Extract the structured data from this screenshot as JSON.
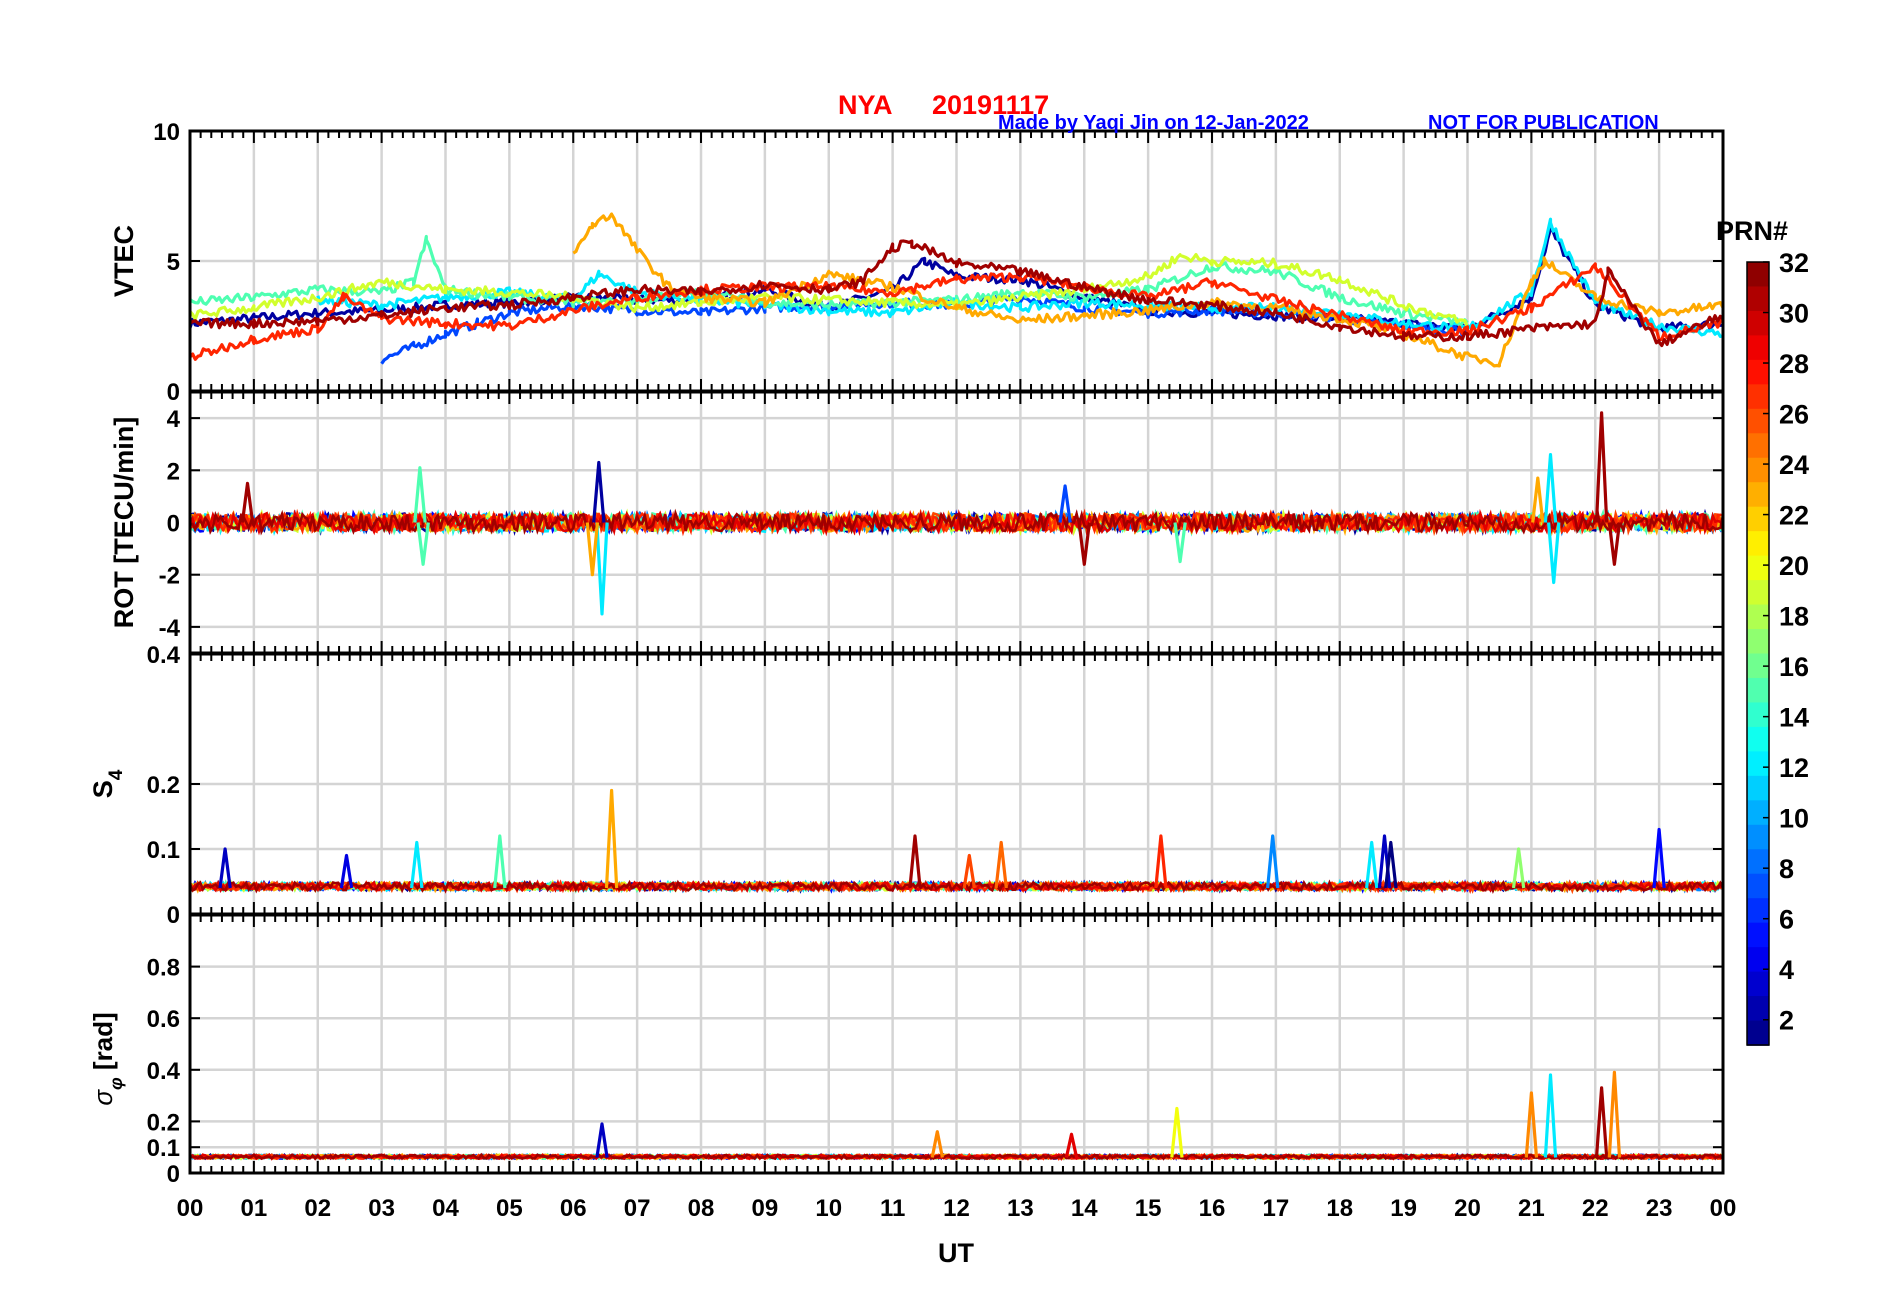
{
  "header": {
    "station": "NYA",
    "date": "20191117",
    "credit": "Made by Yaqi Jin on 12-Jan-2022",
    "notice": "NOT FOR PUBLICATION"
  },
  "colorbar": {
    "title": "PRN#",
    "ticks": [
      "2",
      "4",
      "6",
      "8",
      "10",
      "12",
      "14",
      "16",
      "18",
      "20",
      "22",
      "24",
      "26",
      "28",
      "30",
      "32"
    ],
    "colormap": "jet",
    "range": [
      1,
      32
    ]
  },
  "chart_data": [
    {
      "type": "line",
      "panel": "vtec",
      "ylabel": "VTEC",
      "ylim": [
        0,
        10
      ],
      "yticks": [
        "0",
        "5",
        "10"
      ],
      "grid": true,
      "xlim": [
        0,
        24
      ],
      "series": [
        {
          "prn": 2,
          "x": [
            0,
            1,
            2,
            3,
            4,
            5,
            6,
            7,
            8,
            9,
            10,
            11,
            11.5,
            12,
            13,
            14,
            15,
            16,
            17,
            18,
            19,
            20,
            21,
            21.3,
            22,
            23,
            24
          ],
          "values": [
            2.6,
            2.8,
            3.0,
            3.1,
            3.3,
            3.4,
            3.6,
            3.5,
            3.5,
            3.9,
            3.2,
            3.9,
            5.0,
            4.4,
            4.3,
            3.6,
            3.1,
            3.0,
            2.9,
            2.8,
            2.6,
            2.4,
            3.6,
            6.2,
            3.3,
            2.4,
            2.6
          ]
        },
        {
          "prn": 7,
          "x": [
            3,
            3.5,
            4,
            4.5,
            5,
            6,
            7,
            8,
            9,
            10,
            11,
            12,
            13,
            14,
            15,
            16,
            17,
            18,
            19,
            20
          ],
          "values": [
            1.2,
            1.7,
            2.2,
            2.6,
            3.0,
            3.3,
            3.1,
            3.0,
            3.2,
            3.3,
            3.4,
            3.3,
            3.6,
            3.2,
            3.0,
            3.1,
            3.0,
            2.8,
            2.5,
            2.3
          ]
        },
        {
          "prn": 12,
          "x": [
            2,
            3,
            4,
            5,
            6,
            6.4,
            7,
            8,
            9,
            10,
            11,
            12,
            13,
            14,
            15,
            16,
            17,
            18,
            19,
            20,
            21,
            21.3,
            22,
            23,
            24
          ],
          "values": [
            3.5,
            3.3,
            3.6,
            3.8,
            3.5,
            4.5,
            3.8,
            3.5,
            3.3,
            3.1,
            3.0,
            3.4,
            3.2,
            3.4,
            3.3,
            3.2,
            3.2,
            3.0,
            2.6,
            2.4,
            3.8,
            6.5,
            3.4,
            2.5,
            2.2
          ]
        },
        {
          "prn": 15,
          "x": [
            0,
            1,
            2,
            3,
            3.5,
            3.7,
            4,
            5,
            6,
            7,
            8,
            9,
            10,
            11,
            12,
            13,
            14,
            15,
            16,
            17,
            18,
            19,
            20
          ],
          "values": [
            3.4,
            3.6,
            3.9,
            3.8,
            4.2,
            5.8,
            3.9,
            3.6,
            3.4,
            3.5,
            3.8,
            3.4,
            3.3,
            3.4,
            3.5,
            3.8,
            3.6,
            3.9,
            4.8,
            4.6,
            3.6,
            3.0,
            2.6
          ]
        },
        {
          "prn": 19,
          "x": [
            0,
            1,
            2,
            3,
            4,
            5,
            6,
            7,
            8,
            9,
            10,
            11,
            12,
            13,
            14,
            15,
            15.5,
            16,
            17,
            18,
            19,
            20
          ],
          "values": [
            2.9,
            3.2,
            3.6,
            4.2,
            3.9,
            3.8,
            3.6,
            3.2,
            3.4,
            3.6,
            3.5,
            3.4,
            3.3,
            3.6,
            3.9,
            4.4,
            5.2,
            5.0,
            4.9,
            4.3,
            3.3,
            2.6
          ]
        },
        {
          "prn": 23,
          "x": [
            6,
            6.3,
            6.6,
            7,
            7.5,
            8,
            9,
            10,
            11,
            12,
            13,
            14,
            15,
            16,
            17,
            18,
            19,
            20,
            20.5,
            21,
            21.2,
            22,
            23,
            24
          ],
          "values": [
            5.2,
            6.4,
            6.8,
            5.4,
            4.0,
            3.6,
            3.4,
            4.5,
            4.0,
            3.2,
            2.7,
            2.9,
            3.1,
            3.4,
            3.2,
            2.8,
            2.2,
            1.3,
            1.1,
            4.2,
            5.0,
            3.6,
            3.0,
            3.3
          ]
        },
        {
          "prn": 27,
          "x": [
            0,
            1,
            2,
            2.4,
            3,
            4,
            5,
            6,
            7,
            8,
            9,
            10,
            11,
            12,
            13,
            14,
            15,
            16,
            17,
            18,
            19,
            20,
            21,
            22,
            23,
            24
          ],
          "values": [
            1.3,
            2.0,
            2.4,
            3.6,
            2.8,
            2.6,
            2.5,
            3.1,
            3.6,
            3.9,
            4.0,
            4.0,
            3.8,
            4.3,
            4.4,
            4.0,
            3.6,
            4.2,
            3.5,
            2.9,
            2.3,
            2.3,
            3.2,
            4.8,
            2.1,
            2.6
          ]
        },
        {
          "prn": 31,
          "x": [
            0,
            1,
            2,
            3,
            4,
            5,
            6,
            7,
            8,
            9,
            10,
            10.5,
            11,
            11.3,
            12,
            13,
            14,
            15,
            16,
            17,
            18,
            19,
            20,
            21,
            22,
            22.2,
            23,
            24
          ],
          "values": [
            2.6,
            2.6,
            2.7,
            2.9,
            3.2,
            3.3,
            3.6,
            3.9,
            3.8,
            4.1,
            3.9,
            4.2,
            5.5,
            5.7,
            4.9,
            4.6,
            4.0,
            3.5,
            3.3,
            3.0,
            2.5,
            2.1,
            2.1,
            2.4,
            2.6,
            4.6,
            1.8,
            2.9
          ]
        }
      ]
    },
    {
      "type": "line",
      "panel": "rot",
      "ylabel": "ROT [TECU/min]",
      "ylim": [
        -5,
        5
      ],
      "yticks": [
        "-4",
        "-2",
        "0",
        "2",
        "4"
      ],
      "grid": true,
      "xlim": [
        0,
        24
      ],
      "noise_amplitude": 0.35,
      "spikes": [
        {
          "x": 0.9,
          "value": 1.5,
          "prn": 31
        },
        {
          "x": 3.6,
          "value": 2.1,
          "prn": 15
        },
        {
          "x": 3.65,
          "value": -1.6,
          "prn": 15
        },
        {
          "x": 6.4,
          "value": 2.3,
          "prn": 2
        },
        {
          "x": 6.45,
          "value": -3.5,
          "prn": 12
        },
        {
          "x": 6.3,
          "value": -2.0,
          "prn": 23
        },
        {
          "x": 13.7,
          "value": 1.4,
          "prn": 7
        },
        {
          "x": 14.0,
          "value": -1.6,
          "prn": 31
        },
        {
          "x": 15.5,
          "value": -1.5,
          "prn": 15
        },
        {
          "x": 21.1,
          "value": 1.7,
          "prn": 23
        },
        {
          "x": 21.3,
          "value": 2.6,
          "prn": 12
        },
        {
          "x": 21.35,
          "value": -2.3,
          "prn": 12
        },
        {
          "x": 22.1,
          "value": 4.2,
          "prn": 31
        },
        {
          "x": 22.3,
          "value": -1.6,
          "prn": 31
        }
      ]
    },
    {
      "type": "line",
      "panel": "s4",
      "ylabel": "S4",
      "ylim": [
        0,
        0.4
      ],
      "yticks": [
        "0",
        "0.1",
        "0.2",
        "0.4"
      ],
      "grid": true,
      "xlim": [
        0,
        24
      ],
      "baseline": 0.04,
      "spikes": [
        {
          "x": 0.55,
          "value": 0.1,
          "prn": 3
        },
        {
          "x": 2.45,
          "value": 0.09,
          "prn": 4
        },
        {
          "x": 3.55,
          "value": 0.11,
          "prn": 12
        },
        {
          "x": 4.85,
          "value": 0.12,
          "prn": 15
        },
        {
          "x": 6.6,
          "value": 0.19,
          "prn": 23
        },
        {
          "x": 11.35,
          "value": 0.12,
          "prn": 31
        },
        {
          "x": 12.2,
          "value": 0.09,
          "prn": 26
        },
        {
          "x": 12.7,
          "value": 0.11,
          "prn": 25
        },
        {
          "x": 15.2,
          "value": 0.12,
          "prn": 27
        },
        {
          "x": 16.95,
          "value": 0.12,
          "prn": 9
        },
        {
          "x": 18.5,
          "value": 0.11,
          "prn": 12
        },
        {
          "x": 18.7,
          "value": 0.12,
          "prn": 3
        },
        {
          "x": 18.8,
          "value": 0.11,
          "prn": 1
        },
        {
          "x": 20.8,
          "value": 0.1,
          "prn": 17
        },
        {
          "x": 23.0,
          "value": 0.13,
          "prn": 5
        }
      ]
    },
    {
      "type": "line",
      "panel": "sigma_phi",
      "ylabel": "σ_φ [rad]",
      "ylim": [
        0,
        1
      ],
      "yticks": [
        "0",
        "0.1",
        "0.2",
        "0.4",
        "0.6",
        "0.8"
      ],
      "grid": true,
      "xlim": [
        0,
        24
      ],
      "baseline": 0.06,
      "spikes": [
        {
          "x": 6.45,
          "value": 0.19,
          "prn": 3
        },
        {
          "x": 11.7,
          "value": 0.16,
          "prn": 24
        },
        {
          "x": 13.8,
          "value": 0.15,
          "prn": 29
        },
        {
          "x": 15.45,
          "value": 0.25,
          "prn": 20
        },
        {
          "x": 21.0,
          "value": 0.31,
          "prn": 24
        },
        {
          "x": 21.3,
          "value": 0.38,
          "prn": 12
        },
        {
          "x": 22.1,
          "value": 0.33,
          "prn": 31
        },
        {
          "x": 22.3,
          "value": 0.39,
          "prn": 24
        }
      ]
    }
  ],
  "xaxis": {
    "label": "UT",
    "ticks": [
      "00",
      "01",
      "02",
      "03",
      "04",
      "05",
      "06",
      "07",
      "08",
      "09",
      "10",
      "11",
      "12",
      "13",
      "14",
      "15",
      "16",
      "17",
      "18",
      "19",
      "20",
      "21",
      "22",
      "23",
      "00"
    ]
  }
}
